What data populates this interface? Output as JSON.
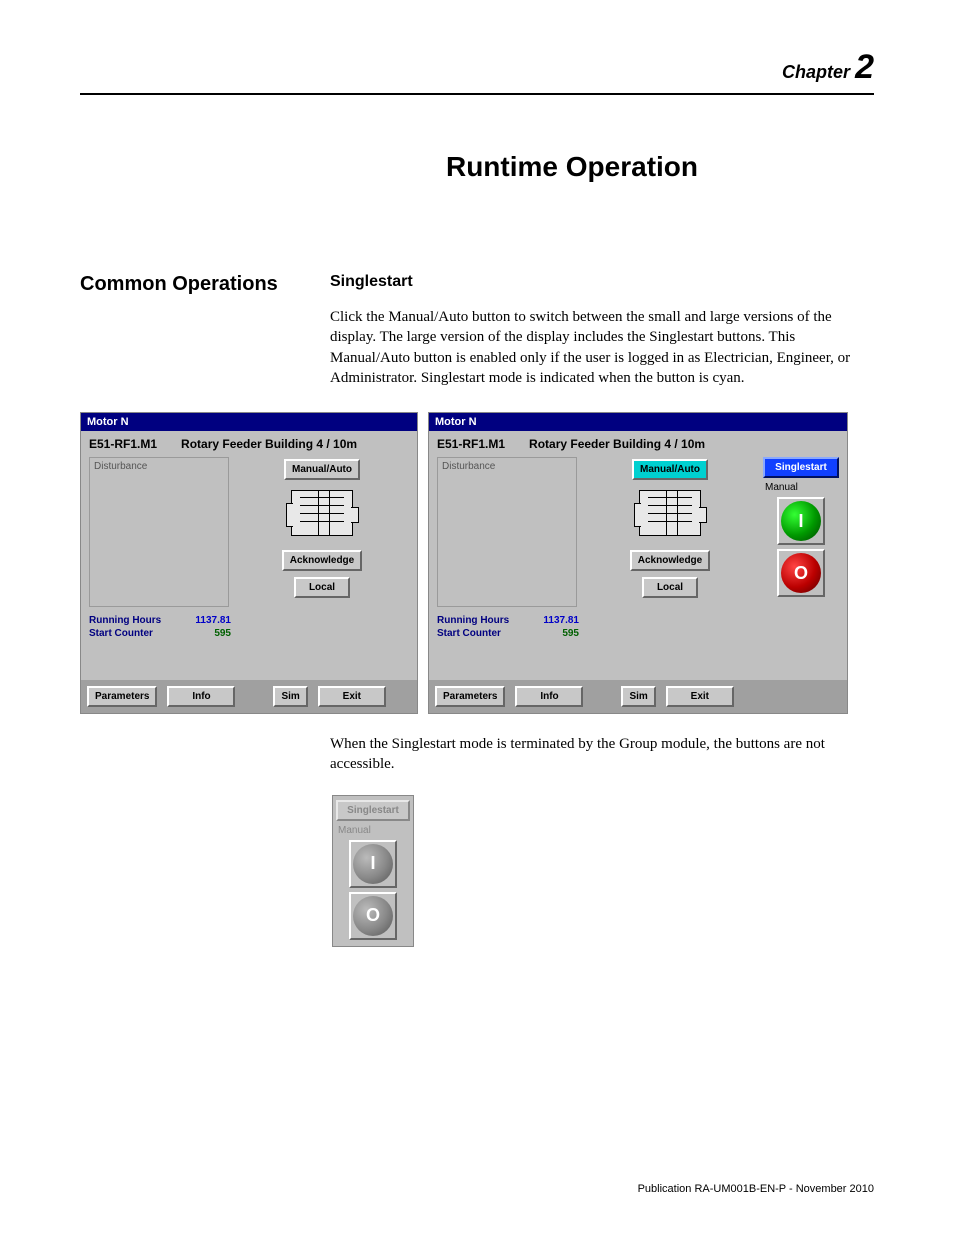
{
  "chapter": {
    "label": "Chapter",
    "number": "2"
  },
  "page_title": "Runtime Operation",
  "leftcol_heading": "Common Operations",
  "subsection_heading": "Singlestart",
  "paragraph1": "Click the Manual/Auto button to switch between the small and large versions of the display. The large version of the display includes the Singlestart buttons. This Manual/Auto button is enabled only if the user is logged in as Electrician, Engineer, or Administrator. Singlestart mode is indicated when the button is cyan.",
  "paragraph2": "When the Singlestart mode is terminated by the Group module, the buttons are not accessible.",
  "hmi": {
    "titlebar": "Motor N",
    "tag": "E51-RF1.M1",
    "desc": "Rotary Feeder Building 4 / 10m",
    "disturbance_label": "Disturbance",
    "manual_auto": "Manual/Auto",
    "acknowledge": "Acknowledge",
    "local": "Local",
    "running_hours_label": "Running Hours",
    "start_counter_label": "Start Counter",
    "running_hours_value": "1137.81",
    "start_counter_value": "595",
    "parameters": "Parameters",
    "info": "Info",
    "sim": "Sim",
    "exit": "Exit",
    "singlestart_title": "Singlestart",
    "singlestart_mode": "Manual",
    "start_glyph": "I",
    "stop_glyph": "O"
  },
  "footer_publication": "Publication RA-UM001B-EN-P - November 2010"
}
